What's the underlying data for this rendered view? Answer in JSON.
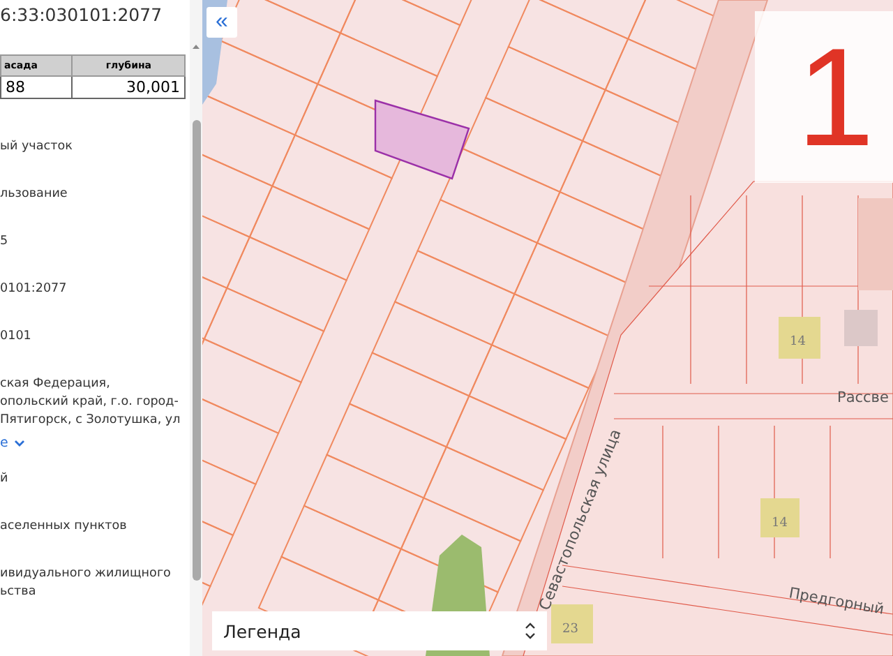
{
  "panel": {
    "title": "6:33:030101:2077",
    "table": {
      "columns": [
        "асада",
        "глубина"
      ],
      "rows": [
        [
          "88",
          "30,001"
        ]
      ]
    },
    "fields": [
      {
        "kind": "text",
        "lines": [
          "ый участок"
        ]
      },
      {
        "kind": "text",
        "lines": [
          "льзование"
        ]
      },
      {
        "kind": "text",
        "lines": [
          "5"
        ]
      },
      {
        "kind": "text",
        "lines": [
          "0101:2077"
        ]
      },
      {
        "kind": "text",
        "lines": [
          "0101"
        ]
      },
      {
        "kind": "text",
        "lines": [
          "ская Федерация,",
          "опольский край, г.о. город-",
          "Пятигорск, с Золотушка, ул"
        ]
      },
      {
        "kind": "link",
        "lines": [
          "е"
        ]
      },
      {
        "kind": "text",
        "lines": [
          "й"
        ]
      },
      {
        "kind": "text",
        "lines": [
          "аселенных пунктов"
        ]
      },
      {
        "kind": "text",
        "lines": [
          "ивидуального жилищного",
          "ьства"
        ]
      }
    ]
  },
  "map": {
    "collapse_button": "«",
    "zoom_level": "1",
    "streets": [
      {
        "kind": "vertical",
        "name": "Севастопольская улица"
      },
      {
        "kind": "east",
        "name": "Рассве"
      },
      {
        "kind": "southeast",
        "name": "Предгорный"
      }
    ],
    "house_numbers": [
      "14",
      "14",
      "23"
    ],
    "legend": {
      "label": "Легенда"
    }
  }
}
